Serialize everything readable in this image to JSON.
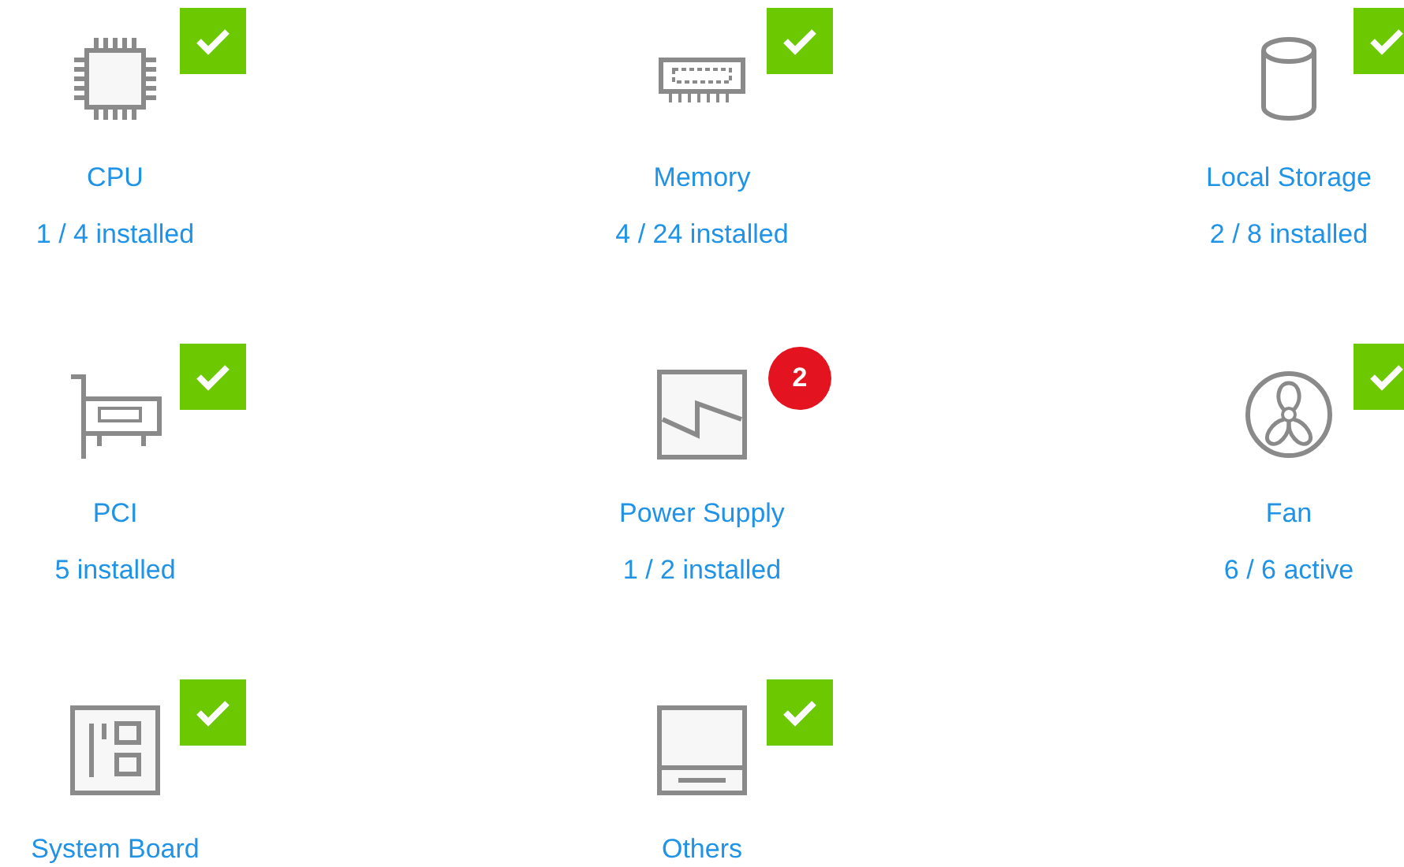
{
  "components": [
    {
      "kind": "cpu",
      "name": "CPU",
      "status": "1 / 4 installed",
      "badge": {
        "kind": "ok"
      }
    },
    {
      "kind": "memory",
      "name": "Memory",
      "status": "4 / 24 installed",
      "badge": {
        "kind": "ok"
      }
    },
    {
      "kind": "storage",
      "name": "Local Storage",
      "status": "2 / 8 installed",
      "badge": {
        "kind": "ok"
      }
    },
    {
      "kind": "pci",
      "name": "PCI",
      "status": "5 installed",
      "badge": {
        "kind": "ok"
      }
    },
    {
      "kind": "power",
      "name": "Power Supply",
      "status": "1 / 2 installed",
      "badge": {
        "kind": "count",
        "count": "2"
      }
    },
    {
      "kind": "fan",
      "name": "Fan",
      "status": "6 / 6 active",
      "badge": {
        "kind": "ok"
      }
    },
    {
      "kind": "board",
      "name": "System Board",
      "badge": {
        "kind": "ok"
      }
    },
    {
      "kind": "others",
      "name": "Others",
      "badge": {
        "kind": "ok"
      }
    }
  ]
}
